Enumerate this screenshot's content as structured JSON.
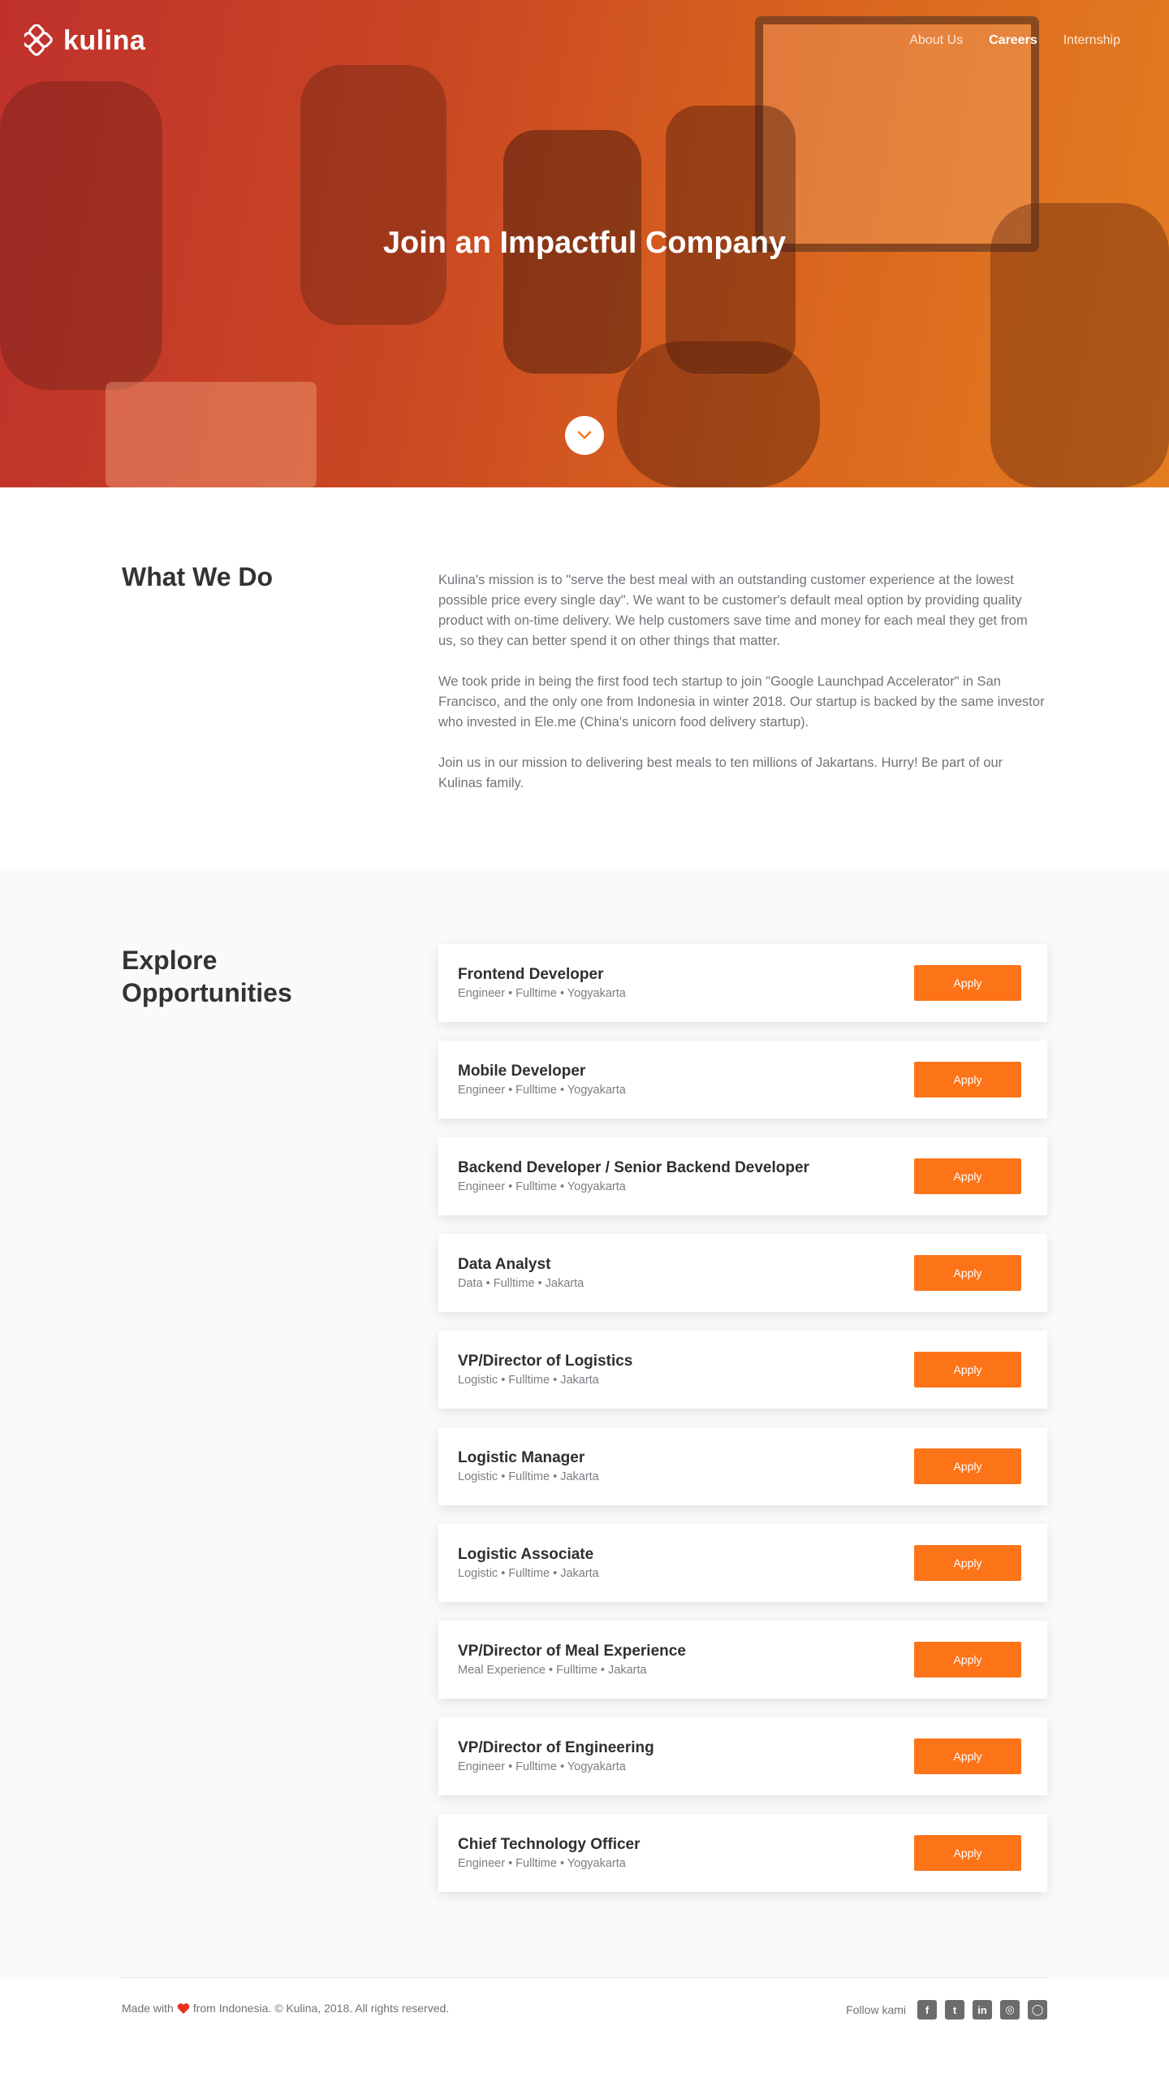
{
  "brand": {
    "name": "kulina",
    "accent": "#fd7418"
  },
  "nav": {
    "items": [
      {
        "label": "About Us",
        "active": false
      },
      {
        "label": "Careers",
        "active": true
      },
      {
        "label": "Internship",
        "active": false
      }
    ]
  },
  "hero": {
    "title": "Join an Impactful Company",
    "scroll_icon": "chevron-down-icon"
  },
  "what_we_do": {
    "heading": "What We Do",
    "paragraphs": [
      "Kulina's mission is to \"serve the best meal with an outstanding customer experience at the lowest possible price every single day\". We want to be customer's default meal option by providing quality product with on-time delivery. We help customers save time and money for each meal they get from us, so they can better spend it on other things that matter.",
      "We took pride in being the first food tech startup to join \"Google Launchpad Accelerator\" in San Francisco, and the only one from Indonesia in winter 2018. Our startup is backed by the same investor who invested in Ele.me (China's unicorn food delivery startup).",
      "Join us in our mission to delivering best meals to ten millions of Jakartans. Hurry! Be part of our Kulinas family."
    ]
  },
  "opportunities": {
    "heading": "Explore Opportunities",
    "apply_label": "Apply",
    "jobs": [
      {
        "title": "Frontend Developer",
        "meta": "Engineer • Fulltime • Yogyakarta"
      },
      {
        "title": "Mobile Developer",
        "meta": "Engineer • Fulltime • Yogyakarta"
      },
      {
        "title": "Backend Developer / Senior Backend Developer",
        "meta": "Engineer • Fulltime • Yogyakarta"
      },
      {
        "title": "Data Analyst",
        "meta": "Data • Fulltime • Jakarta"
      },
      {
        "title": "VP/Director of Logistics",
        "meta": "Logistic • Fulltime • Jakarta"
      },
      {
        "title": "Logistic Manager",
        "meta": "Logistic • Fulltime • Jakarta"
      },
      {
        "title": "Logistic Associate",
        "meta": "Logistic • Fulltime • Jakarta"
      },
      {
        "title": "VP/Director of Meal Experience",
        "meta": "Meal Experience • Fulltime • Jakarta"
      },
      {
        "title": "VP/Director of Engineering",
        "meta": "Engineer • Fulltime • Yogyakarta"
      },
      {
        "title": "Chief Technology Officer",
        "meta": "Engineer • Fulltime • Yogyakarta"
      }
    ]
  },
  "footer": {
    "made_with": "Made with",
    "from_text": "from Indonesia. © Kulina, 2018. All rights reserved.",
    "follow_label": "Follow kami",
    "socials": [
      {
        "name": "facebook-icon",
        "glyph": "f"
      },
      {
        "name": "twitter-icon",
        "glyph": "t"
      },
      {
        "name": "linkedin-icon",
        "glyph": "in"
      },
      {
        "name": "instagram-icon",
        "glyph": "◎"
      },
      {
        "name": "line-icon",
        "glyph": "◯"
      }
    ]
  }
}
